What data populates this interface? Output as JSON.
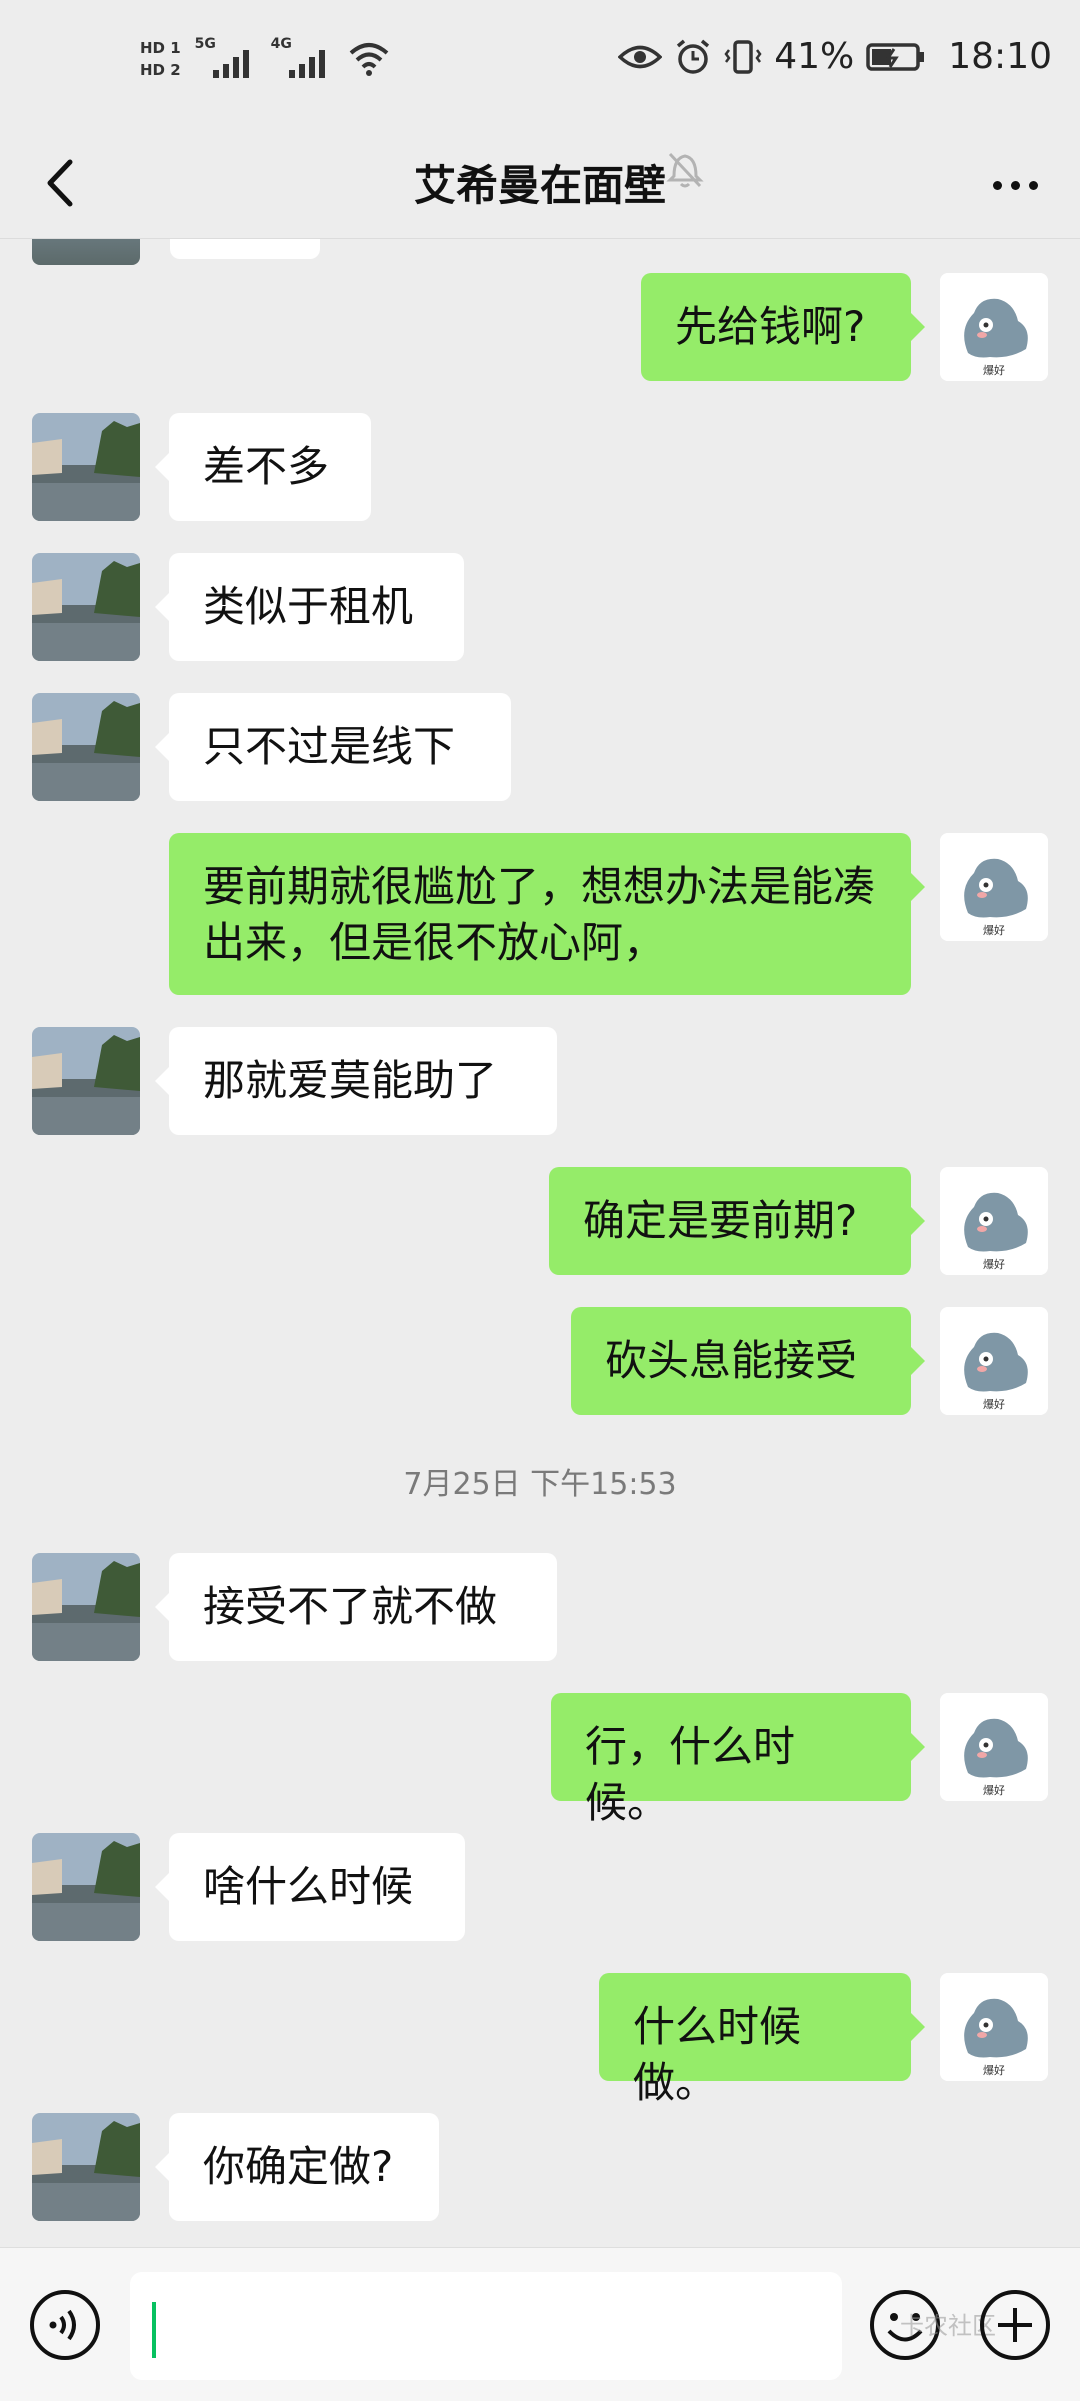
{
  "status_bar": {
    "hd1": "HD 1",
    "hd2": "HD 2",
    "net1": "5G",
    "net2": "4G",
    "battery_pct": "41%",
    "time": "18:10"
  },
  "header": {
    "title": "艾希曼在面壁"
  },
  "messages": [
    {
      "side": "out",
      "text": "先给钱啊?"
    },
    {
      "side": "in",
      "text": "差不多"
    },
    {
      "side": "in",
      "text": "类似于租机"
    },
    {
      "side": "in",
      "text": "只不过是线下"
    },
    {
      "side": "out",
      "text": "要前期就很尴尬了，想想办法是能凑出来，但是很不放心阿，"
    },
    {
      "side": "in",
      "text": "那就爱莫能助了"
    },
    {
      "side": "out",
      "text": "确定是要前期?"
    },
    {
      "side": "out",
      "text": "砍头息能接受"
    },
    {
      "side": "time",
      "text": "7月25日 下午15:53"
    },
    {
      "side": "in",
      "text": "接受不了就不做"
    },
    {
      "side": "out",
      "text": "行，什么时候。"
    },
    {
      "side": "in",
      "text": "啥什么时候"
    },
    {
      "side": "out",
      "text": "什么时候做。"
    },
    {
      "side": "in",
      "text": "你确定做?"
    }
  ],
  "my_avatar_caption": "爆好",
  "watermark": "卡农社区",
  "colors": {
    "sent_bubble": "#95ec69",
    "received_bubble": "#ffffff",
    "background": "#ededed",
    "cursor": "#07c160"
  }
}
